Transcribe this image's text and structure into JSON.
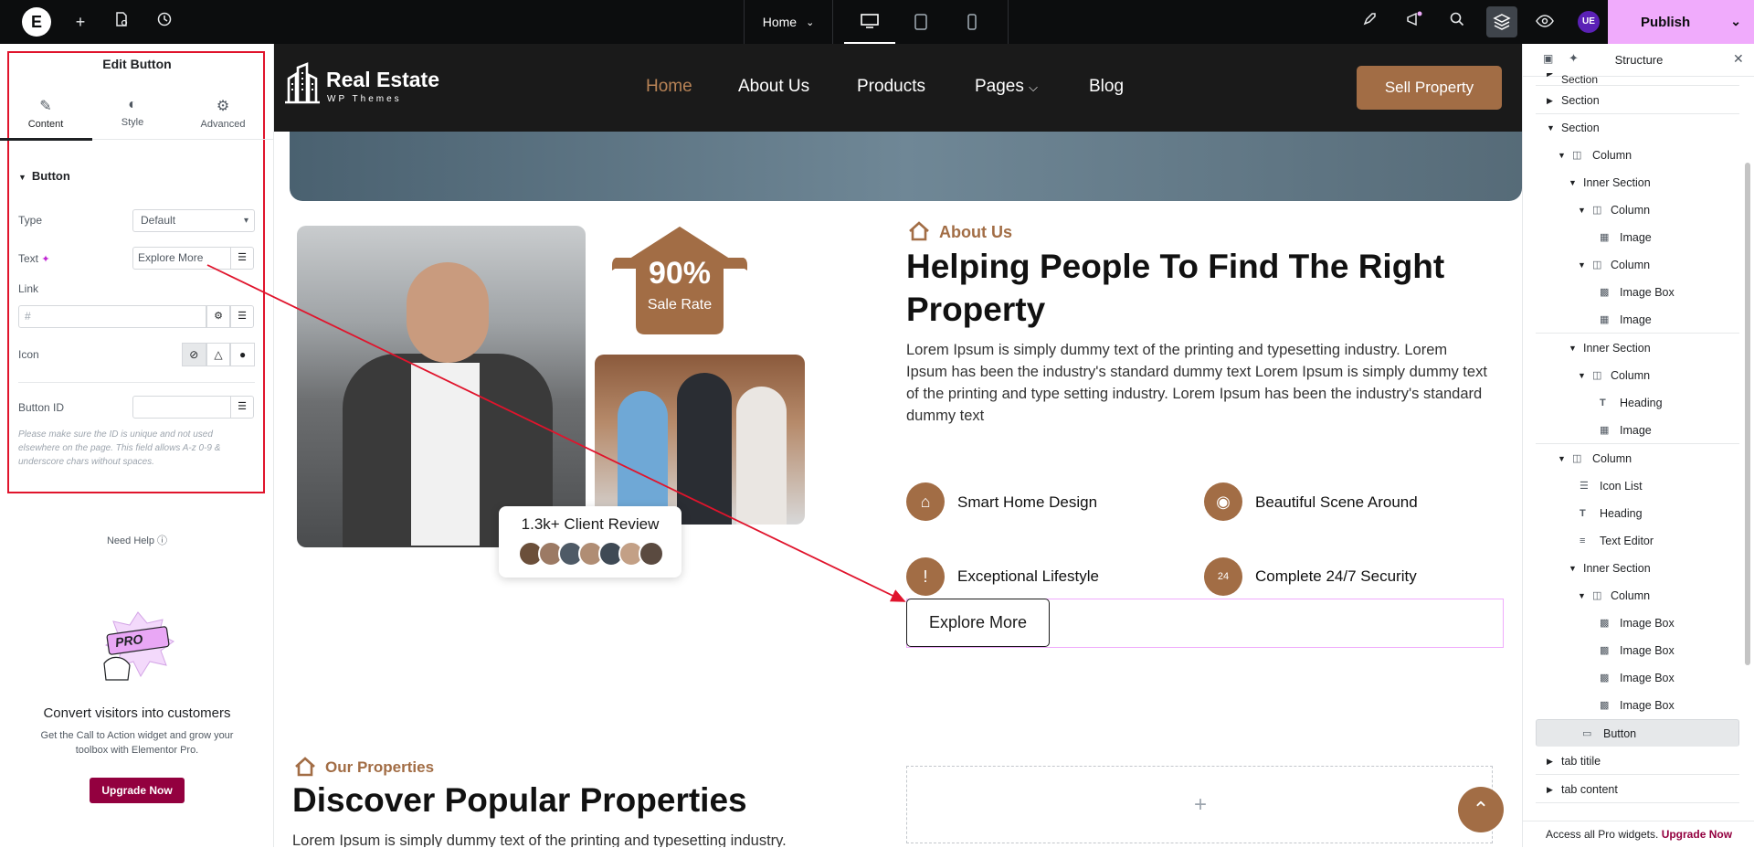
{
  "topbar": {
    "page_name": "Home",
    "publish_label": "Publish",
    "user_initials": "UE"
  },
  "left_panel": {
    "title": "Edit Button",
    "tabs": [
      {
        "label": "Content"
      },
      {
        "label": "Style"
      },
      {
        "label": "Advanced"
      }
    ],
    "section_title": "Button",
    "type_label": "Type",
    "type_value": "Default",
    "text_label": "Text",
    "text_value": "Explore More",
    "link_label": "Link",
    "link_placeholder": "#",
    "icon_label": "Icon",
    "button_id_label": "Button ID",
    "note": "Please make sure the ID is unique and not used elsewhere on the page. This field allows A-z 0-9 & underscore chars without spaces.",
    "need_help": "Need Help",
    "promo_badge": "PRO",
    "promo_title": "Convert visitors into customers",
    "promo_text": "Get the Call to Action widget and grow your toolbox with Elementor Pro.",
    "upgrade_label": "Upgrade Now"
  },
  "site": {
    "logo_title": "Real Estate",
    "logo_subtitle": "WP Themes",
    "nav": [
      {
        "label": "Home"
      },
      {
        "label": "About Us"
      },
      {
        "label": "Products"
      },
      {
        "label": "Pages"
      },
      {
        "label": "Blog"
      }
    ],
    "cta": "Sell Property",
    "badge_big": "90%",
    "badge_small": "Sale Rate",
    "review": "1.3k+ Client Review",
    "about_tag": "About Us",
    "about_heading": "Helping People To Find The Right Property",
    "about_text": "Lorem Ipsum is simply dummy text of the printing and typesetting industry. Lorem Ipsum has been the industry's standard dummy text Lorem Ipsum is simply dummy text of the printing and type setting industry. Lorem Ipsum has been the industry's standard dummy text",
    "features": [
      {
        "label": "Smart Home Design",
        "icon": "home-icon"
      },
      {
        "label": "Beautiful Scene Around",
        "icon": "binoculars-icon"
      },
      {
        "label": "Exceptional Lifestyle",
        "icon": "exclamation-icon"
      },
      {
        "label": "Complete 24/7 Security",
        "icon": "support-24-icon"
      }
    ],
    "button_label": "Explore More",
    "props_tag": "Our Properties",
    "props_heading": "Discover Popular Properties",
    "props_text": "Lorem Ipsum is simply dummy text of the printing and typesetting industry.",
    "accent": "#a26d45"
  },
  "structure": {
    "title": "Structure",
    "nodes": [
      {
        "label": "Section"
      },
      {
        "label": "Section"
      },
      {
        "label": "Section"
      },
      {
        "label": "Column"
      },
      {
        "label": "Inner Section"
      },
      {
        "label": "Column"
      },
      {
        "label": "Image"
      },
      {
        "label": "Column"
      },
      {
        "label": "Image Box"
      },
      {
        "label": "Image"
      },
      {
        "label": "Inner Section"
      },
      {
        "label": "Column"
      },
      {
        "label": "Heading"
      },
      {
        "label": "Image"
      },
      {
        "label": "Column"
      },
      {
        "label": "Icon List"
      },
      {
        "label": "Heading"
      },
      {
        "label": "Text Editor"
      },
      {
        "label": "Inner Section"
      },
      {
        "label": "Column"
      },
      {
        "label": "Image Box"
      },
      {
        "label": "Image Box"
      },
      {
        "label": "Image Box"
      },
      {
        "label": "Image Box"
      },
      {
        "label": "Button"
      },
      {
        "label": "tab titile"
      },
      {
        "label": "tab content"
      }
    ],
    "footer_text": "Access all Pro widgets.",
    "footer_link": "Upgrade Now"
  }
}
